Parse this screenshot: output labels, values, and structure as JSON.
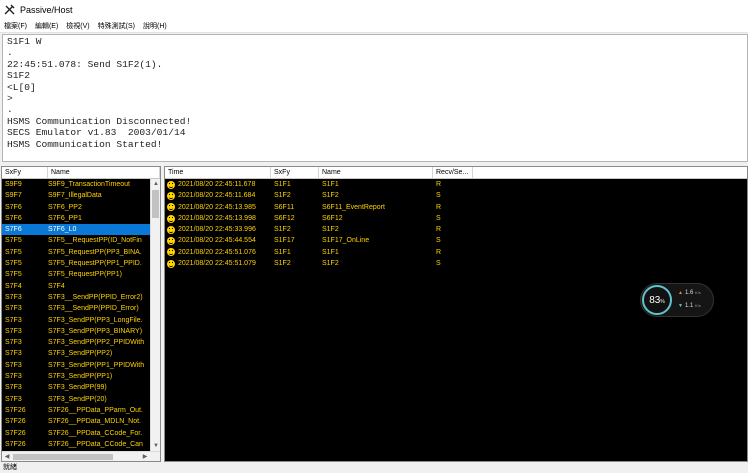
{
  "window": {
    "title": "Passive/Host"
  },
  "menu": [
    "檔案(F)",
    "編輯(E)",
    "檢視(V)",
    "特殊測試(S)",
    "說明(H)"
  ],
  "log_lines": [
    "S1F1 W",
    ".",
    "22:45:51.078: Send S1F2(1).",
    "S1F2",
    "<L[0]",
    ">",
    ".",
    "HSMS Communication Disconnected!",
    "SECS Emulator v1.83  2003/01/14",
    "HSMS Communication Started!"
  ],
  "message_list": {
    "columns": [
      "SxFy",
      "Name"
    ],
    "rows": [
      {
        "sxfy": "S9F9",
        "name": "S9F9_TransactionTimeout"
      },
      {
        "sxfy": "S9F7",
        "name": "S9F7_IllegalData"
      },
      {
        "sxfy": "S7F6",
        "name": "S7F6_PP2"
      },
      {
        "sxfy": "S7F6",
        "name": "S7F6_PP1"
      },
      {
        "sxfy": "S7F6",
        "name": "S7F6_L0"
      },
      {
        "sxfy": "S7F5",
        "name": "S7F5__RequestPP(ID_NotFin"
      },
      {
        "sxfy": "S7F5",
        "name": "S7F5_RequestPP(PP3_BINA."
      },
      {
        "sxfy": "S7F5",
        "name": "S7F5_RequestPP(PP1_PPID."
      },
      {
        "sxfy": "S7F5",
        "name": "S7F5_RequestPP(PP1)"
      },
      {
        "sxfy": "S7F4",
        "name": "S7F4"
      },
      {
        "sxfy": "S7F3",
        "name": "S7F3__SendPP(PPID_Error2)"
      },
      {
        "sxfy": "S7F3",
        "name": "S7F3__SendPP(PPID_Error)"
      },
      {
        "sxfy": "S7F3",
        "name": "S7F3_SendPP(PP3_LongFile."
      },
      {
        "sxfy": "S7F3",
        "name": "S7F3_SendPP(PP3_BINARY)"
      },
      {
        "sxfy": "S7F3",
        "name": "S7F3_SendPP(PP2_PPIDWith"
      },
      {
        "sxfy": "S7F3",
        "name": "S7F3_SendPP(PP2)"
      },
      {
        "sxfy": "S7F3",
        "name": "S7F3_SendPP(PP1_PPIDWith"
      },
      {
        "sxfy": "S7F3",
        "name": "S7F3_SendPP(PP1)"
      },
      {
        "sxfy": "S7F3",
        "name": "S7F3_SendPP(99)"
      },
      {
        "sxfy": "S7F3",
        "name": "S7F3_SendPP(20)"
      },
      {
        "sxfy": "S7F26",
        "name": "S7F26__PPData_PParm_Out."
      },
      {
        "sxfy": "S7F26",
        "name": "S7F26__PPData_MDLN_Not."
      },
      {
        "sxfy": "S7F26",
        "name": "S7F26__PPData_CCode_For."
      },
      {
        "sxfy": "S7F26",
        "name": "S7F26__PPData_CCode_Can"
      }
    ],
    "selected_index": 4
  },
  "transactions": {
    "columns": [
      "Time",
      "SxFy",
      "Name",
      "Recv/Se..."
    ],
    "rows": [
      {
        "time": "2021/08/20 22:45:11.678",
        "sxfy": "S1F1",
        "name": "S1F1",
        "dir": "R"
      },
      {
        "time": "2021/08/20 22:45:11.684",
        "sxfy": "S1F2",
        "name": "S1F2",
        "dir": "S"
      },
      {
        "time": "2021/08/20 22:45:13.985",
        "sxfy": "S6F11",
        "name": "S6F11_EventReport",
        "dir": "R"
      },
      {
        "time": "2021/08/20 22:45:13.998",
        "sxfy": "S6F12",
        "name": "S6F12",
        "dir": "S"
      },
      {
        "time": "2021/08/20 22:45:33.996",
        "sxfy": "S1F2",
        "name": "S1F2",
        "dir": "R"
      },
      {
        "time": "2021/08/20 22:45:44.554",
        "sxfy": "S1F17",
        "name": "S1F17_OnLine",
        "dir": "S"
      },
      {
        "time": "2021/08/20 22:45:51.076",
        "sxfy": "S1F1",
        "name": "S1F1",
        "dir": "R"
      },
      {
        "time": "2021/08/20 22:45:51.079",
        "sxfy": "S1F2",
        "name": "S1F2",
        "dir": "S"
      }
    ]
  },
  "net_widget": {
    "percent": "83",
    "percent_sign": "%",
    "upload": "1.6",
    "download": "1.1",
    "unit": "K/s",
    "ring_color": "#5fc4d0"
  },
  "status": {
    "text": "就緒"
  },
  "colors": {
    "list_text": "#ffd200",
    "selection": "#0a78d7"
  }
}
